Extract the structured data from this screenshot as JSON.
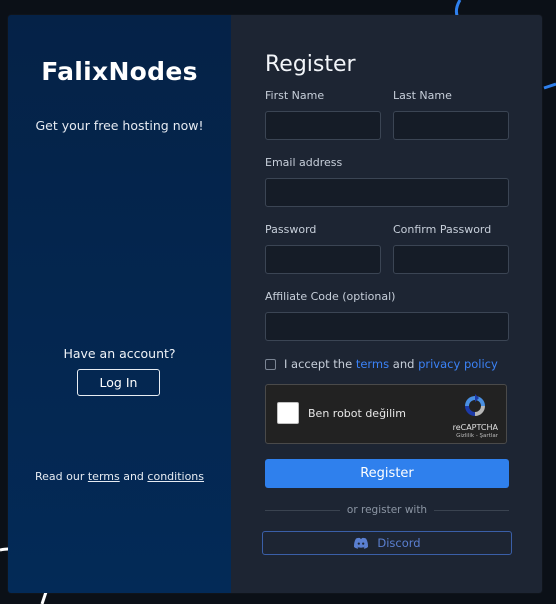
{
  "brand": {
    "name": "FalixNodes",
    "tagline": "Get your free hosting now!"
  },
  "side": {
    "have_account": "Have an account?",
    "login_label": "Log In",
    "read_prefix": "Read our",
    "terms": "terms",
    "and": "and",
    "conditions": "conditions"
  },
  "form": {
    "title": "Register",
    "first_name_label": "First Name",
    "first_name_value": "",
    "last_name_label": "Last Name",
    "last_name_value": "",
    "email_label": "Email address",
    "email_value": "",
    "password_label": "Password",
    "password_value": "",
    "confirm_password_label": "Confirm Password",
    "confirm_password_value": "",
    "affiliate_label": "Affiliate Code (optional)",
    "affiliate_value": "",
    "accept_prefix": "I accept the",
    "accept_terms": "terms",
    "accept_and": "and",
    "accept_privacy": "privacy policy",
    "accept_checked": false,
    "register_label": "Register",
    "or_register_with": "or register with",
    "discord_label": "Discord"
  },
  "captcha": {
    "label": "Ben robot değilim",
    "brand": "reCAPTCHA",
    "links": "Gizlilik - Şartlar"
  },
  "colors": {
    "accent": "#2f80ed",
    "link": "#3b82f6",
    "left_panel": "#052247",
    "right_panel": "#1d2533",
    "discord": "#5a7fd0"
  }
}
